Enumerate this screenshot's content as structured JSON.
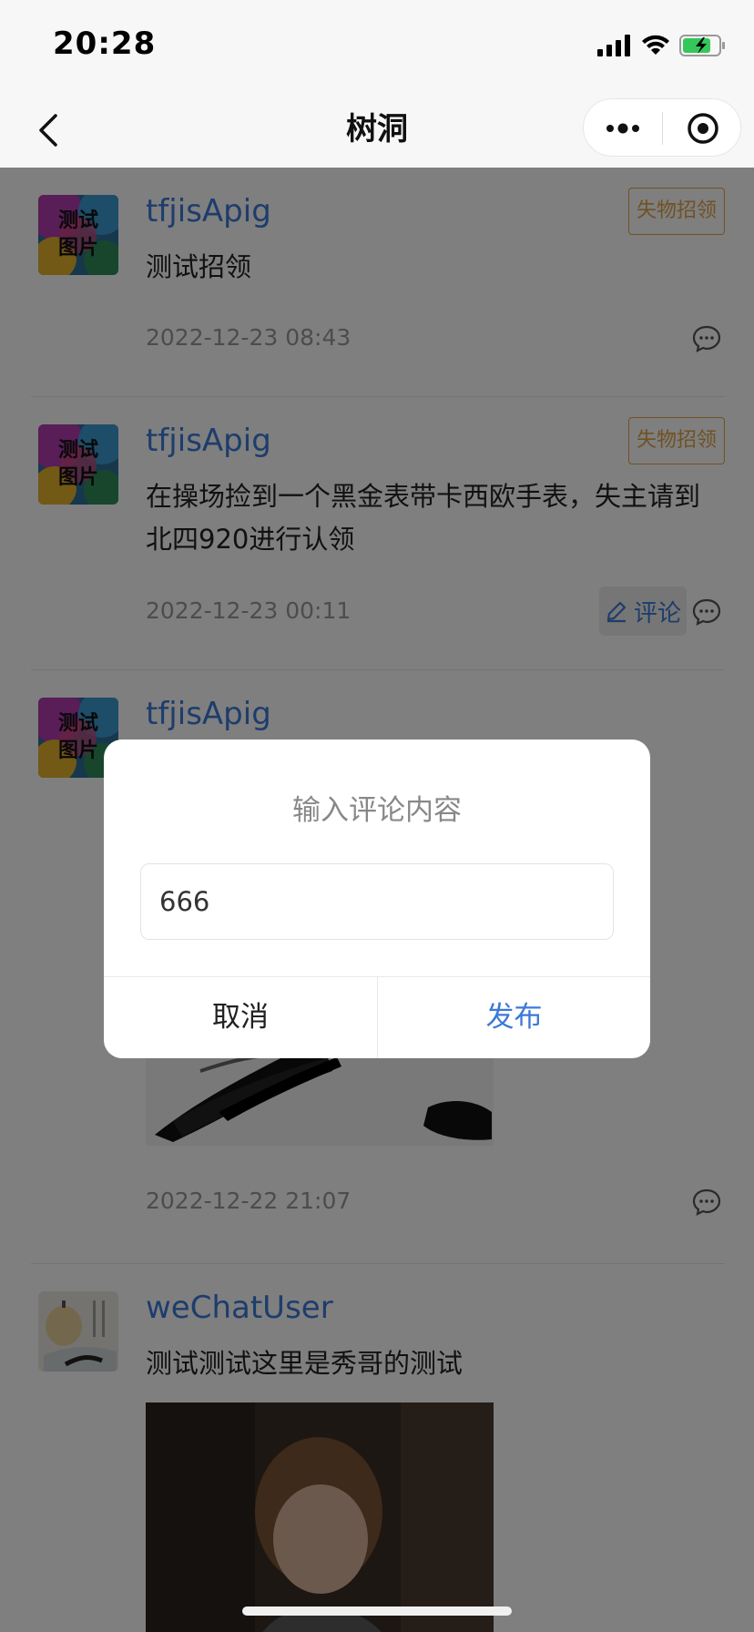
{
  "status_bar": {
    "time": "20:28"
  },
  "nav": {
    "title": "树洞"
  },
  "posts": [
    {
      "user": "tfjisApig",
      "avatar_text_1": "测试",
      "avatar_text_2": "图片",
      "tag": "失物招领",
      "content": "测试招领",
      "time": "2022-12-23 08:43"
    },
    {
      "user": "tfjisApig",
      "avatar_text_1": "测试",
      "avatar_text_2": "图片",
      "tag": "失物招领",
      "content": "在操场捡到一个黑金表带卡西欧手表，失主请到北四920进行认领",
      "time": "2022-12-23 00:11",
      "action_label": "评论"
    },
    {
      "user": "tfjisApig",
      "avatar_text_1": "测试",
      "avatar_text_2": "图片",
      "time": "2022-12-22 21:07"
    },
    {
      "user": "weChatUser",
      "content": "测试测试这里是秀哥的测试"
    }
  ],
  "dialog": {
    "title": "输入评论内容",
    "input_value": "666",
    "cancel_label": "取消",
    "confirm_label": "发布"
  },
  "colors": {
    "accent": "#3b7ad8",
    "tag": "#e1a346"
  }
}
